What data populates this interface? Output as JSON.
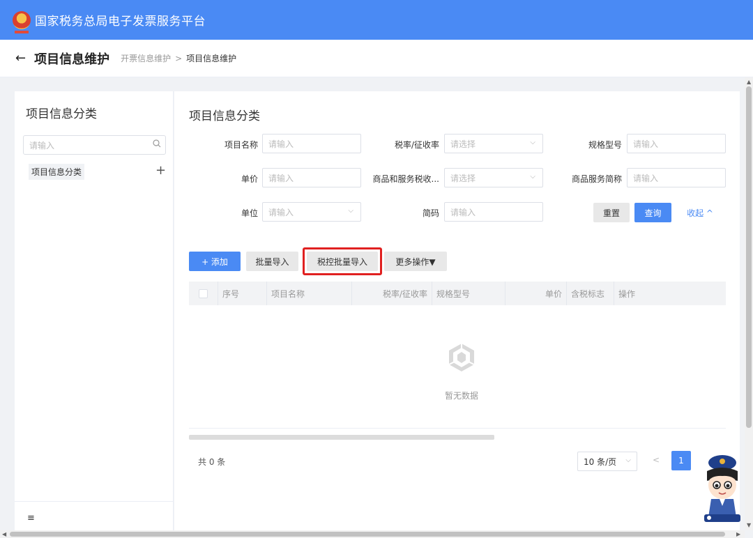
{
  "header": {
    "title": "国家税务总局电子发票服务平台"
  },
  "breadcrumb_bar": {
    "back_icon": "arrow-left-icon",
    "page_title": "项目信息维护",
    "crumbs": [
      "开票信息维护",
      "项目信息维护"
    ],
    "separator": ">"
  },
  "sidebar": {
    "title": "项目信息分类",
    "search_placeholder": "请输入",
    "tree_items": [
      {
        "label": "项目信息分类"
      }
    ],
    "add_symbol": "+",
    "collapse_icon": "≡"
  },
  "main": {
    "title": "项目信息分类",
    "filters": {
      "project_name": {
        "label": "项目名称",
        "placeholder": "请输入"
      },
      "tax_rate": {
        "label": "税率/征收率",
        "placeholder": "请选择"
      },
      "spec_model": {
        "label": "规格型号",
        "placeholder": "请输入"
      },
      "unit_price": {
        "label": "单价",
        "placeholder": "请输入"
      },
      "tax_category": {
        "label": "商品和服务税收...",
        "placeholder": "请选择"
      },
      "service_short": {
        "label": "商品服务简称",
        "placeholder": "请输入"
      },
      "unit": {
        "label": "单位",
        "placeholder": "请输入"
      },
      "short_code": {
        "label": "简码",
        "placeholder": "请输入"
      }
    },
    "filter_actions": {
      "reset": "重置",
      "query": "查询",
      "collapse": "收起 ^"
    },
    "toolbar": {
      "add": "+ 添加",
      "batch_import": "批量导入",
      "tax_batch_import": "税控批量导入",
      "more_ops": "更多操作▼"
    },
    "table": {
      "columns": [
        "序号",
        "项目名称",
        "税率/征收率",
        "规格型号",
        "单价",
        "含税标志",
        "操作"
      ],
      "rows": [],
      "empty_text": "暂无数据"
    },
    "pagination": {
      "total": "共 0 条",
      "page_size": "10 条/页",
      "prev": "<",
      "current_page": "1"
    }
  },
  "colors": {
    "brand_blue": "#4a8af4",
    "highlight_red": "#e02020"
  }
}
